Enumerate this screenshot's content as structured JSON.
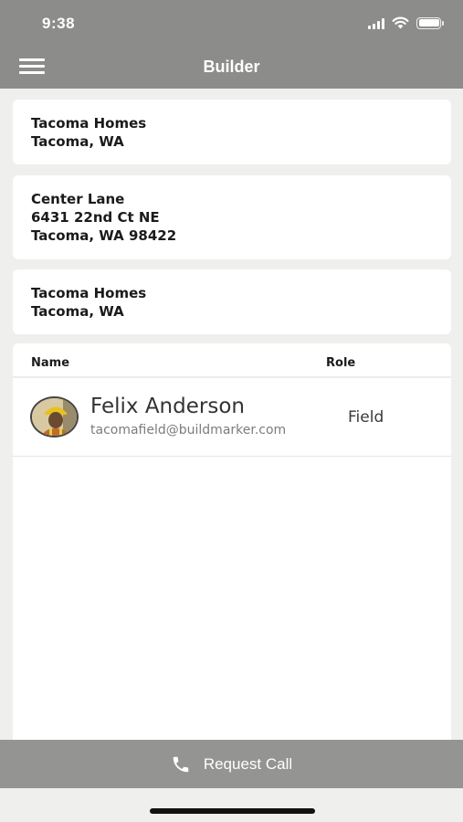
{
  "status_bar": {
    "time": "9:38"
  },
  "header": {
    "title": "Builder",
    "menu_icon": "hamburger-menu-icon"
  },
  "cards": [
    {
      "lines": [
        "Tacoma Homes",
        "Tacoma, WA"
      ]
    },
    {
      "lines": [
        "Center Lane",
        "6431 22nd Ct NE",
        "Tacoma, WA 98422"
      ]
    },
    {
      "lines": [
        "Tacoma Homes",
        "Tacoma, WA"
      ]
    }
  ],
  "team": {
    "columns": {
      "name": "Name",
      "role": "Role"
    },
    "members": [
      {
        "name": "Felix Anderson",
        "email": "tacomafield@buildmarker.com",
        "role": "Field"
      }
    ]
  },
  "footer": {
    "call_label": "Request Call",
    "call_icon": "phone-icon"
  }
}
